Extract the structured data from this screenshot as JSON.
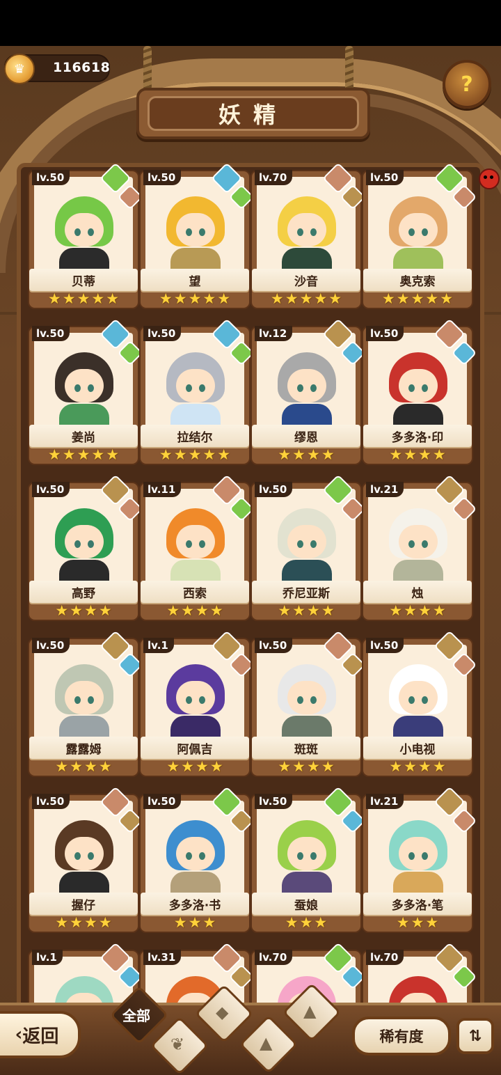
{
  "header": {
    "coins": "116618",
    "title": "妖精",
    "help_icon": "question-sprout-icon"
  },
  "colors": {
    "grass": "#7cc84a",
    "water": "#5ab7d8",
    "earth": "#b9924f",
    "fire": "#c98a6a",
    "star": "#ffd23a"
  },
  "fairies": [
    {
      "level": "lv.50",
      "name": "贝蒂",
      "stars": 5,
      "e1": "grass",
      "e2": "fire",
      "hair": "#76c847",
      "body": "#2b2b2b"
    },
    {
      "level": "lv.50",
      "name": "望",
      "stars": 5,
      "e1": "water",
      "e2": "grass",
      "hair": "#f2b830",
      "body": "#b89a55"
    },
    {
      "level": "lv.70",
      "name": "沙音",
      "stars": 5,
      "e1": "fire",
      "e2": "earth",
      "hair": "#f4cf45",
      "body": "#2d4a3a"
    },
    {
      "level": "lv.50",
      "name": "奥克索",
      "stars": 5,
      "e1": "grass",
      "e2": "fire",
      "hair": "#e3a86a",
      "body": "#9fc05b"
    },
    {
      "level": "lv.50",
      "name": "姜尚",
      "stars": 5,
      "e1": "water",
      "e2": "grass",
      "hair": "#3b3029",
      "body": "#4a9a5a"
    },
    {
      "level": "lv.50",
      "name": "拉结尔",
      "stars": 5,
      "e1": "water",
      "e2": "grass",
      "hair": "#b5b9c2",
      "body": "#cfe4f4"
    },
    {
      "level": "lv.12",
      "name": "缪恩",
      "stars": 4,
      "e1": "earth",
      "e2": "water",
      "hair": "#a9a9a9",
      "body": "#2a4a8c"
    },
    {
      "level": "lv.50",
      "name": "多多洛·印",
      "stars": 4,
      "e1": "fire",
      "e2": "water",
      "hair": "#c9332c",
      "body": "#2a2a2a"
    },
    {
      "level": "lv.50",
      "name": "高野",
      "stars": 4,
      "e1": "earth",
      "e2": "fire",
      "hair": "#2e9e53",
      "body": "#2a2a2a"
    },
    {
      "level": "lv.11",
      "name": "西索",
      "stars": 4,
      "e1": "fire",
      "e2": "grass",
      "hair": "#f08a2a",
      "body": "#d7e2b5"
    },
    {
      "level": "lv.50",
      "name": "乔尼亚斯",
      "stars": 4,
      "e1": "grass",
      "e2": "fire",
      "hair": "#e2e2d0",
      "body": "#2b4f56"
    },
    {
      "level": "lv.21",
      "name": "烛",
      "stars": 4,
      "e1": "earth",
      "e2": "fire",
      "hair": "#f5f2ea",
      "body": "#b3b59a"
    },
    {
      "level": "lv.50",
      "name": "露露姆",
      "stars": 4,
      "e1": "earth",
      "e2": "water",
      "hair": "#bfc7b3",
      "body": "#9aa3a6"
    },
    {
      "level": "lv.1",
      "name": "阿佩吉",
      "stars": 4,
      "e1": "earth",
      "e2": "fire",
      "hair": "#5b3b9e",
      "body": "#3a2a66"
    },
    {
      "level": "lv.50",
      "name": "斑斑",
      "stars": 4,
      "e1": "fire",
      "e2": "earth",
      "hair": "#e8e8e8",
      "body": "#6b7a6a"
    },
    {
      "level": "lv.50",
      "name": "小电视",
      "stars": 4,
      "e1": "earth",
      "e2": "fire",
      "hair": "#ffffff",
      "body": "#3a3d7a"
    },
    {
      "level": "lv.50",
      "name": "握仔",
      "stars": 4,
      "e1": "fire",
      "e2": "earth",
      "hair": "#5a3a24",
      "body": "#2a2a2a"
    },
    {
      "level": "lv.50",
      "name": "多多洛·书",
      "stars": 3,
      "e1": "grass",
      "e2": "earth",
      "hair": "#3d8ecf",
      "body": "#b4a07a"
    },
    {
      "level": "lv.50",
      "name": "蚕娘",
      "stars": 3,
      "e1": "grass",
      "e2": "water",
      "hair": "#9ad04a",
      "body": "#5a4a7a"
    },
    {
      "level": "lv.21",
      "name": "多多洛·笔",
      "stars": 3,
      "e1": "earth",
      "e2": "fire",
      "hair": "#8ad8c8",
      "body": "#d9a85a"
    },
    {
      "level": "lv.1",
      "name": "",
      "stars": 0,
      "e1": "fire",
      "e2": "water",
      "hair": "#9ed9c2",
      "body": "#555555"
    },
    {
      "level": "lv.31",
      "name": "",
      "stars": 0,
      "e1": "fire",
      "e2": "earth",
      "hair": "#e26a2a",
      "body": "#8a5a3a"
    },
    {
      "level": "lv.70",
      "name": "",
      "stars": 0,
      "e1": "grass",
      "e2": "water",
      "hair": "#f6a6c8",
      "body": "#ffffff"
    },
    {
      "level": "lv.70",
      "name": "",
      "stars": 0,
      "e1": "earth",
      "e2": "grass",
      "hair": "#c9332c",
      "body": "#2a2a2a"
    }
  ],
  "bottom": {
    "back_label": "返回",
    "tab_all": "全部",
    "sort_label": "稀有度"
  }
}
